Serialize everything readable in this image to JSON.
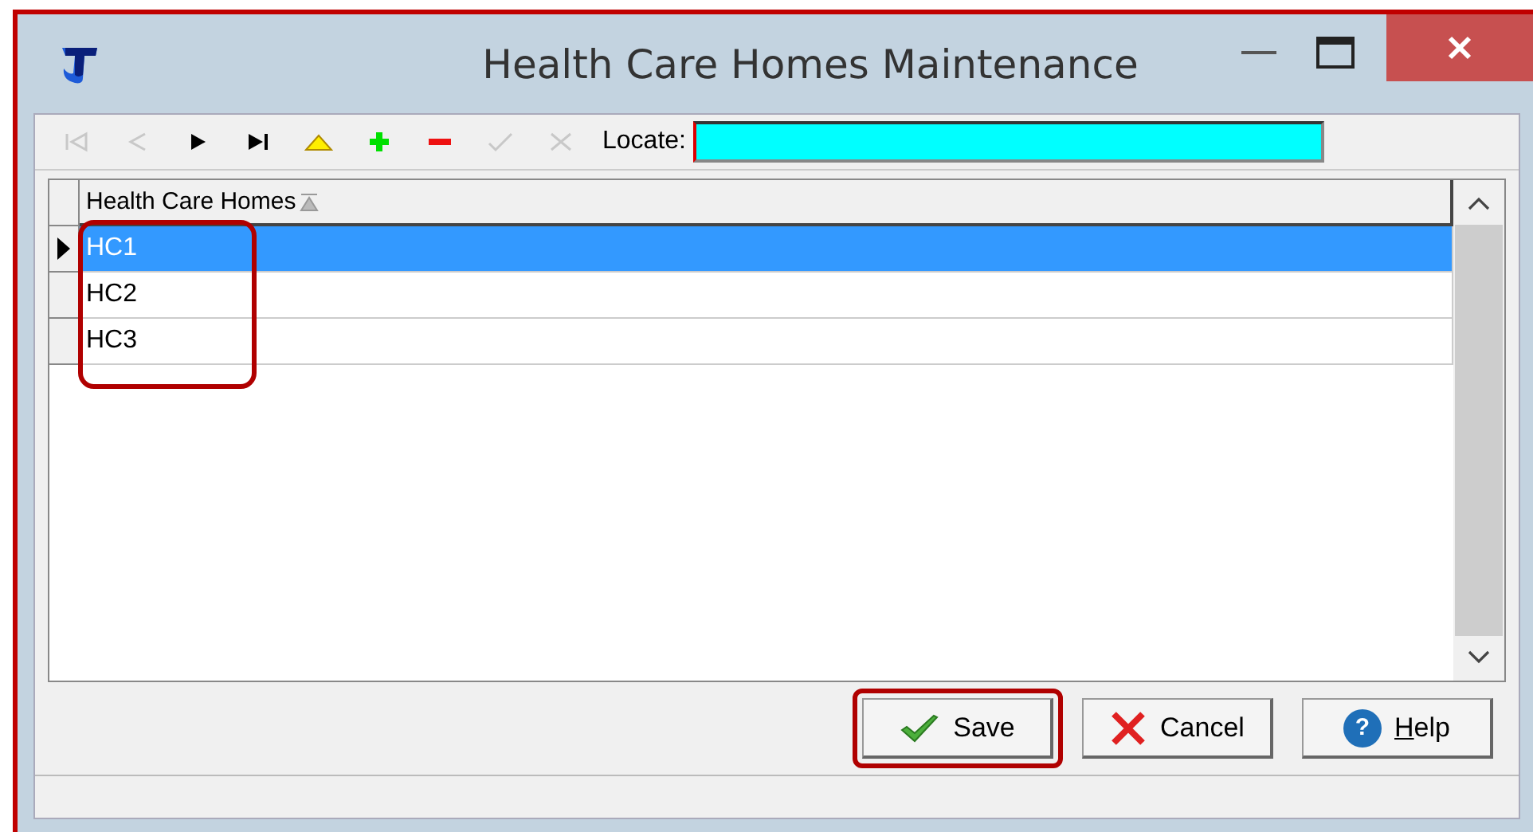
{
  "window": {
    "title": "Health Care Homes Maintenance"
  },
  "toolbar": {
    "buttons": [
      {
        "kind": "first",
        "disabled": true
      },
      {
        "kind": "prior",
        "disabled": true
      },
      {
        "kind": "next",
        "disabled": false
      },
      {
        "kind": "last",
        "disabled": false
      },
      {
        "kind": "edit",
        "disabled": false
      },
      {
        "kind": "insert",
        "disabled": false
      },
      {
        "kind": "delete",
        "disabled": false
      },
      {
        "kind": "post",
        "disabled": true
      },
      {
        "kind": "cancel",
        "disabled": true
      }
    ],
    "locate": {
      "label": "Locate:"
    }
  },
  "grid": {
    "columns": [
      {
        "label": "Health Care Homes",
        "sorted": true
      }
    ],
    "highlighted": true,
    "rows": [
      {
        "cells": [
          "HC1"
        ],
        "selected": true
      },
      {
        "cells": [
          "HC2"
        ],
        "selected": false
      },
      {
        "cells": [
          "HC3"
        ],
        "selected": false
      }
    ]
  },
  "buttons": [
    {
      "kind": "save",
      "label": "Save",
      "highlighted": true,
      "mnemonic_underlined": false
    },
    {
      "kind": "cancel",
      "label": "Cancel",
      "highlighted": false,
      "mnemonic_underlined": false
    },
    {
      "kind": "help",
      "label": "Help",
      "icon_text": "?",
      "highlighted": false,
      "mnemonic_underlined": true
    }
  ]
}
